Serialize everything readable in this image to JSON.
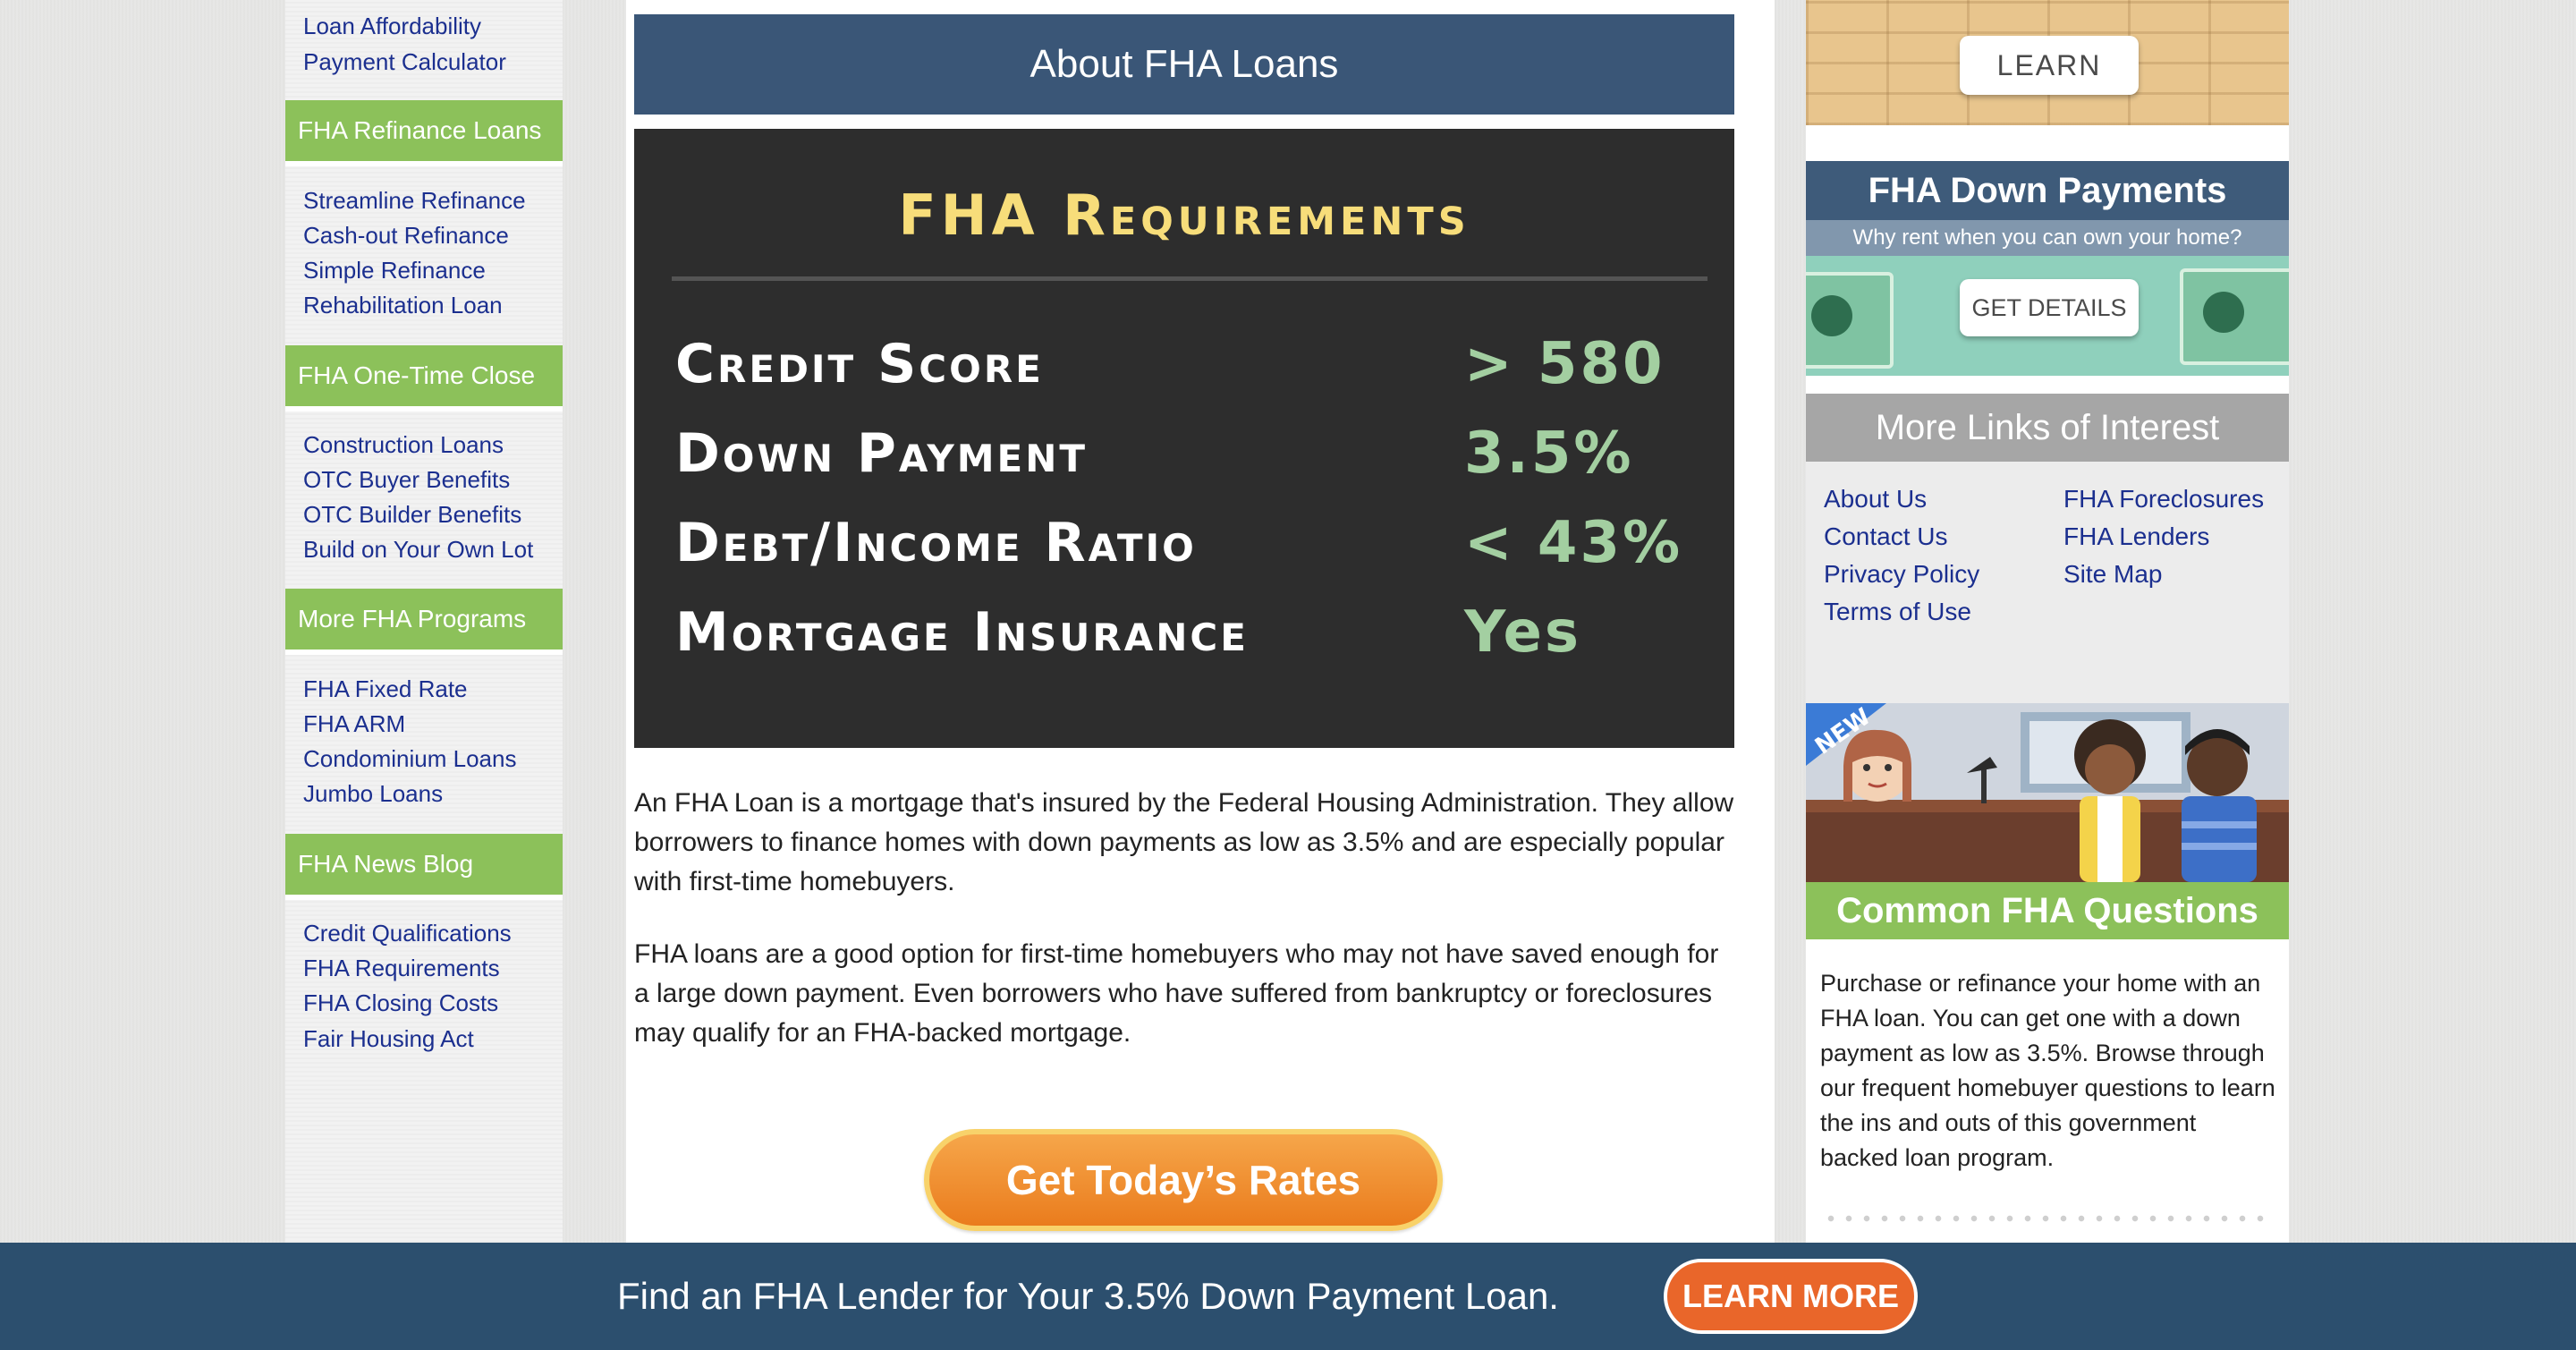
{
  "left_sidebar": {
    "top_links": [
      "Loan Affordability",
      "Payment Calculator"
    ],
    "sections": [
      {
        "title": "FHA Refinance Loans",
        "links": [
          "Streamline Refinance",
          "Cash-out Refinance",
          "Simple Refinance",
          "Rehabilitation Loan"
        ]
      },
      {
        "title": "FHA One-Time Close",
        "links": [
          "Construction Loans",
          "OTC Buyer Benefits",
          "OTC Builder Benefits",
          "Build on Your Own Lot"
        ]
      },
      {
        "title": "More FHA Programs",
        "links": [
          "FHA Fixed Rate",
          "FHA ARM",
          "Condominium Loans",
          "Jumbo Loans"
        ]
      },
      {
        "title": "FHA News Blog",
        "links": [
          "Credit Qualifications",
          "FHA Requirements",
          "FHA Closing Costs",
          "Fair Housing Act"
        ]
      }
    ]
  },
  "main": {
    "title": "About FHA Loans",
    "requirements": {
      "title": "FHA Requirements",
      "rows": [
        {
          "label": "Credit Score",
          "value": "> 580"
        },
        {
          "label": "Down Payment",
          "value": "3.5%"
        },
        {
          "label": "Debt/Income Ratio",
          "value": "< 43%"
        },
        {
          "label": "Mortgage Insurance",
          "value": "Yes"
        }
      ]
    },
    "paragraph_1": "An FHA Loan is a mortgage that's insured by the Federal Housing Administration. They allow borrowers to finance homes with down payments as low as 3.5% and are especially popular with first-time homebuyers.",
    "paragraph_2": "FHA loans are a good option for first-time homebuyers who may not have saved enough for a large down payment. Even borrowers who have suffered from bankruptcy or foreclosures may qualify for an FHA-backed mortgage.",
    "cta_label": "Get Today’s Rates"
  },
  "right_sidebar": {
    "learn_button": "LEARN",
    "down_payments": {
      "title": "FHA Down Payments",
      "subtitle": "Why rent when you can own your home?",
      "button": "GET DETAILS"
    },
    "more_links": {
      "title": "More Links of Interest",
      "col1": [
        "About Us",
        "Contact Us",
        "Privacy Policy",
        "Terms of Use"
      ],
      "col2": [
        "FHA Foreclosures",
        "FHA Lenders",
        "Site Map"
      ]
    },
    "questions": {
      "badge": "NEW",
      "title": "Common FHA Questions",
      "text": "Purchase or refinance your home with an FHA loan. You can get one with a down payment as low as 3.5%. Browse through our frequent homebuyer questions to learn the ins and outs of this government backed loan program."
    }
  },
  "bottom_bar": {
    "text": "Find an FHA Lender for Your 3.5% Down Payment Loan.",
    "button": "LEARN MORE"
  },
  "colors": {
    "nav_link": "#1b2f8f",
    "section_green": "#8cc15a",
    "header_blue": "#3a5677",
    "cta_orange": "#ea7c1d",
    "bottom_bar": "#2c4f6e",
    "board_bg": "#2d2d2d",
    "board_title": "#f7dd7a",
    "board_value": "#a3cfa1"
  }
}
